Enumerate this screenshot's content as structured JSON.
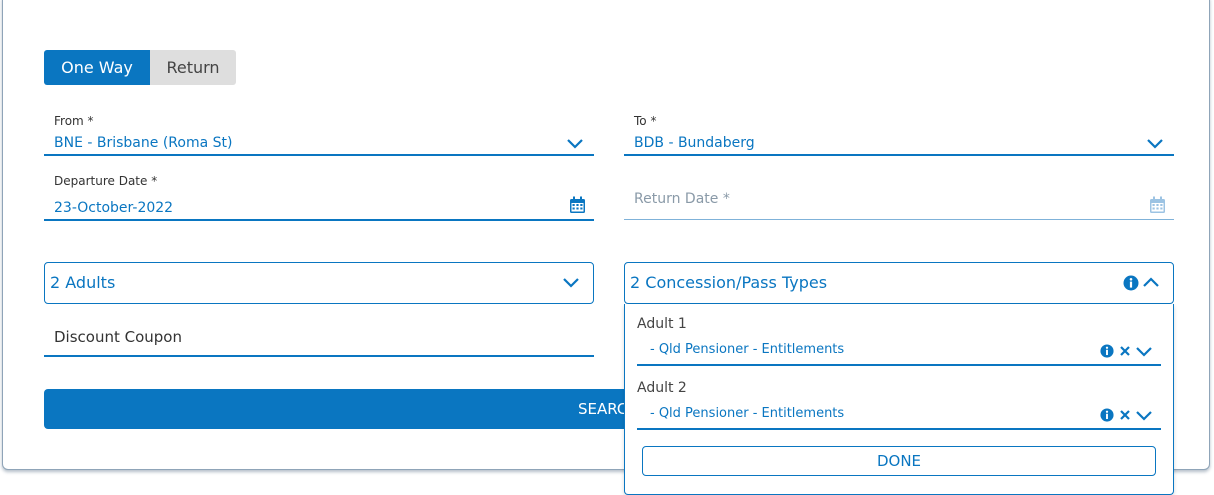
{
  "trip_type": {
    "one_way": "One Way",
    "return": "Return",
    "selected": "One Way"
  },
  "from": {
    "label": "From *",
    "value": "BNE - Brisbane (Roma St)"
  },
  "to": {
    "label": "To *",
    "value": "BDB - Bundaberg"
  },
  "departure": {
    "label": "Departure Date *",
    "value": "23-October-2022"
  },
  "return_date": {
    "placeholder": "Return Date *"
  },
  "passengers": {
    "value": "2 Adults"
  },
  "concessions": {
    "value": "2 Concession/Pass Types",
    "expanded": true,
    "items": [
      {
        "label": "Adult 1",
        "value": "- Qld Pensioner - Entitlements"
      },
      {
        "label": "Adult 2",
        "value": "- Qld Pensioner - Entitlements"
      }
    ],
    "done_label": "DONE"
  },
  "coupon": {
    "placeholder": "Discount Coupon"
  },
  "search": {
    "label": "SEARCH"
  },
  "colors": {
    "accent": "#0a76c1",
    "toggle_inactive": "#dedede"
  }
}
